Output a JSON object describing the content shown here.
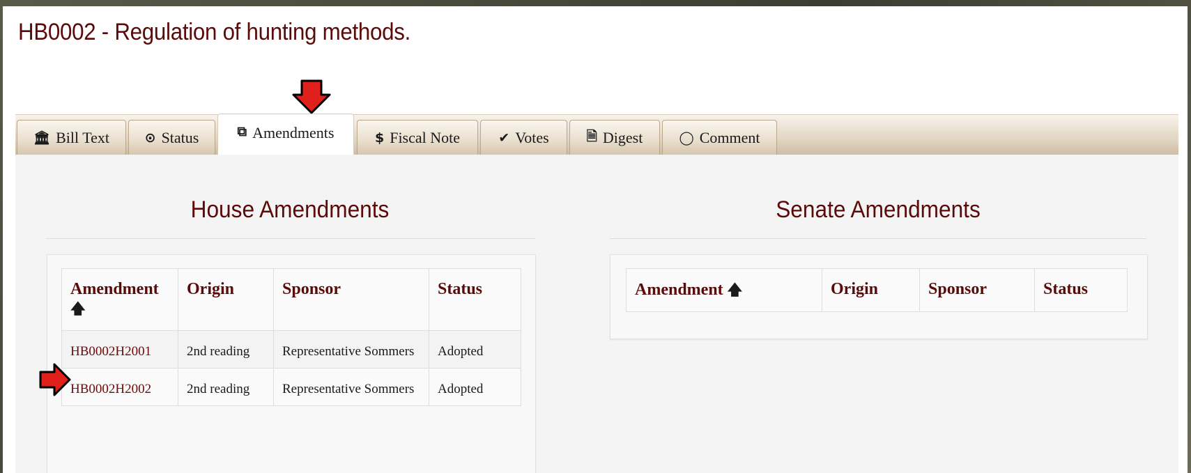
{
  "page_title": "HB0002 - Regulation of hunting methods.",
  "tabs": [
    {
      "icon": "🏛",
      "label": "Bill Text"
    },
    {
      "icon": "⊙",
      "label": "Status"
    },
    {
      "icon": "⧉",
      "label": "Amendments"
    },
    {
      "icon": "$",
      "label": "Fiscal Note"
    },
    {
      "icon": "✔",
      "label": "Votes"
    },
    {
      "icon": "🗎",
      "label": "Digest"
    },
    {
      "icon": "◯",
      "label": "Comment"
    }
  ],
  "active_tab": "Amendments",
  "house": {
    "title": "House Amendments",
    "headers": [
      "Amendment",
      "Origin",
      "Sponsor",
      "Status"
    ],
    "sort_icon": "🡅",
    "rows": [
      {
        "amendment": "HB0002H2001",
        "origin": "2nd reading",
        "sponsor": "Representative Sommers",
        "status": "Adopted"
      },
      {
        "amendment": "HB0002H2002",
        "origin": "2nd reading",
        "sponsor": "Representative Sommers",
        "status": "Adopted"
      }
    ]
  },
  "senate": {
    "title": "Senate Amendments",
    "headers": [
      "Amendment",
      "Origin",
      "Sponsor",
      "Status"
    ],
    "sort_icon": "🡅"
  },
  "colors": {
    "accent": "#5b0a0a",
    "annotation_arrow": "#e0201a"
  }
}
